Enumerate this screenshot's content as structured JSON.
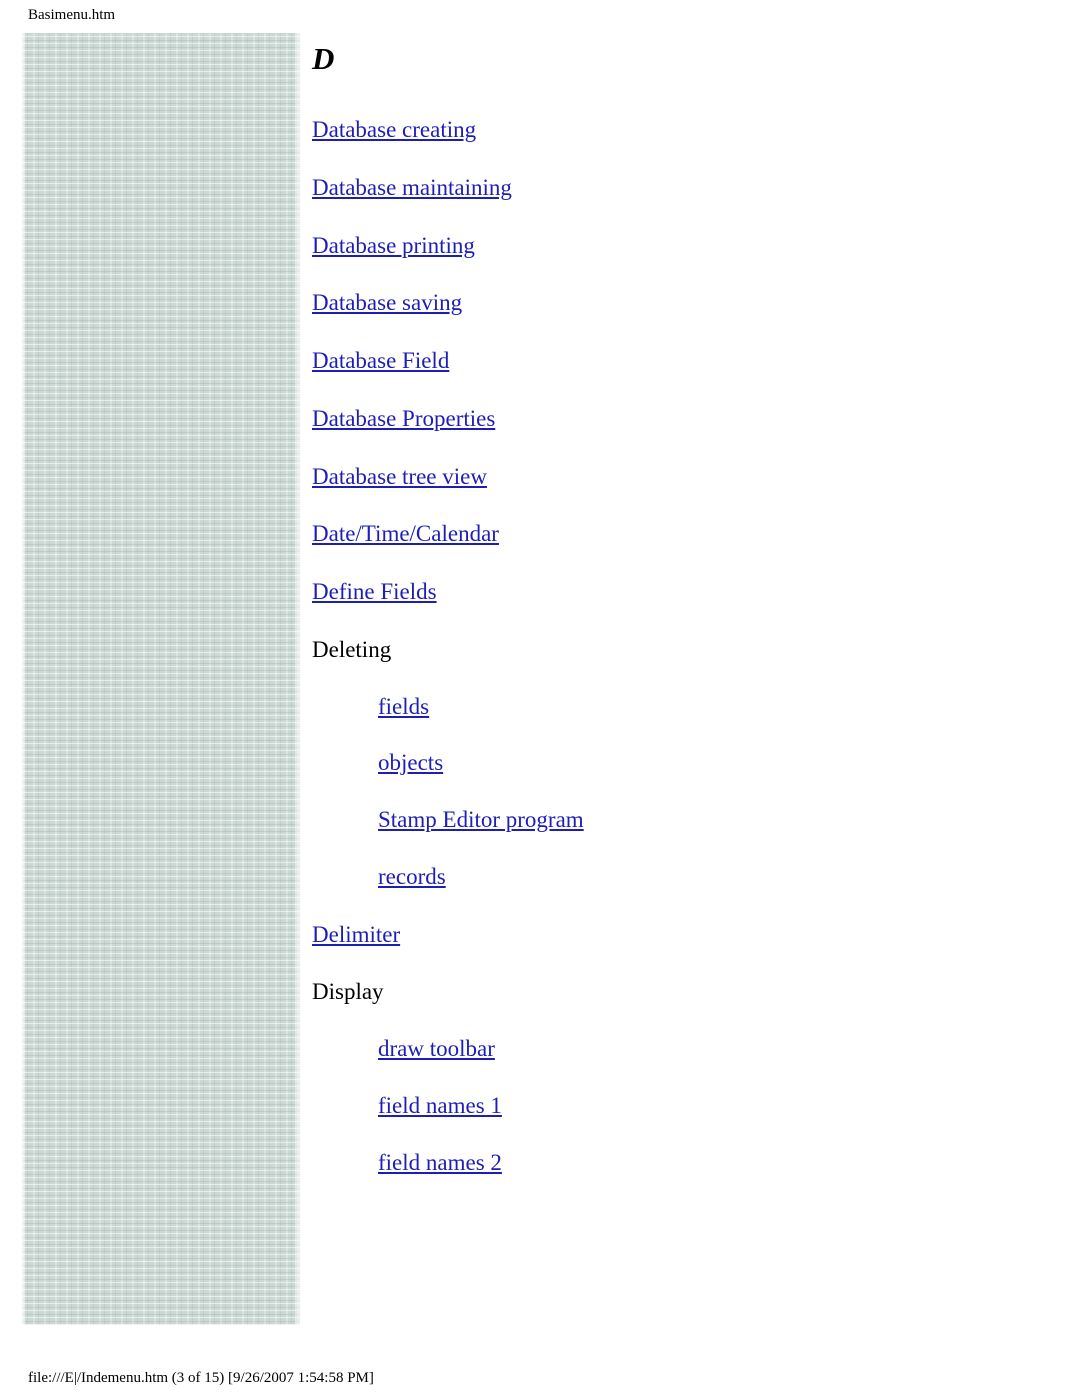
{
  "header": {
    "title": "Basimenu.htm"
  },
  "footer": {
    "text": "file:///E|/Indemenu.htm (3 of 15) [9/26/2007 1:54:58 PM]"
  },
  "main": {
    "section_letter": "D",
    "entries": [
      {
        "label": "Database creating",
        "link": true,
        "sub": false
      },
      {
        "label": "Database maintaining",
        "link": true,
        "sub": false
      },
      {
        "label": "Database printing",
        "link": true,
        "sub": false
      },
      {
        "label": "Database saving",
        "link": true,
        "sub": false
      },
      {
        "label": "Database Field",
        "link": true,
        "sub": false
      },
      {
        "label": "Database Properties",
        "link": true,
        "sub": false
      },
      {
        "label": "Database tree view",
        "link": true,
        "sub": false
      },
      {
        "label": "Date/Time/Calendar",
        "link": true,
        "sub": false
      },
      {
        "label": "Define Fields",
        "link": true,
        "sub": false
      },
      {
        "label": "Deleting",
        "link": false,
        "sub": false
      },
      {
        "label": "fields",
        "link": true,
        "sub": true
      },
      {
        "label": "objects",
        "link": true,
        "sub": true
      },
      {
        "label": "Stamp Editor program",
        "link": true,
        "sub": true
      },
      {
        "label": "records",
        "link": true,
        "sub": true
      },
      {
        "label": "Delimiter ",
        "link": true,
        "sub": false
      },
      {
        "label": "Display",
        "link": false,
        "sub": false
      },
      {
        "label": "draw toolbar",
        "link": true,
        "sub": true
      },
      {
        "label": "field names 1",
        "link": true,
        "sub": true
      },
      {
        "label": "field names 2",
        "link": true,
        "sub": true
      }
    ]
  },
  "colors": {
    "link": "#1d1db8",
    "sidebar": "#cbd8d4",
    "text": "#000000"
  }
}
